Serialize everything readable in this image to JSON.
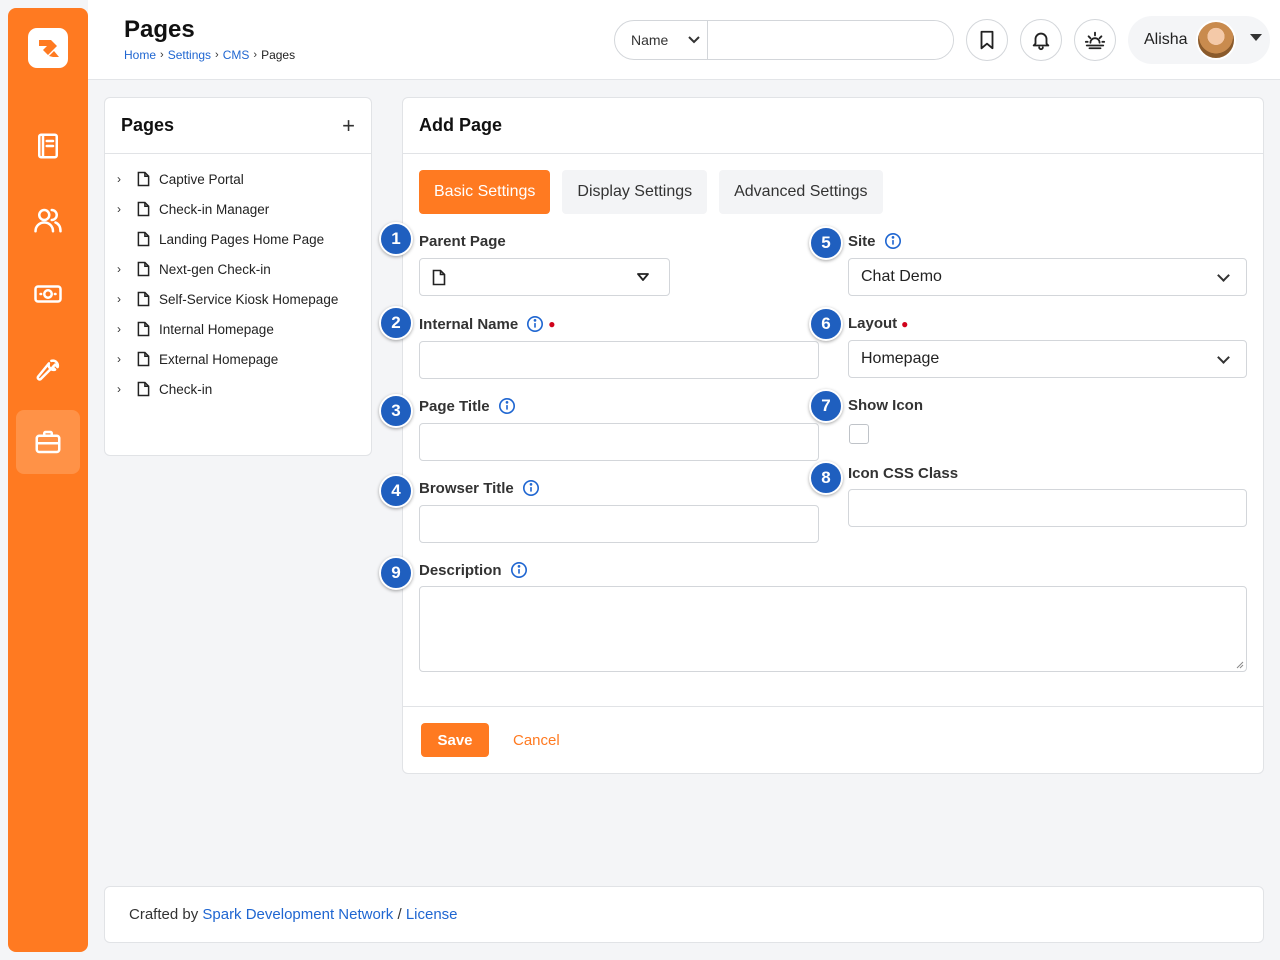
{
  "header": {
    "title": "Pages",
    "breadcrumb": [
      "Home",
      "Settings",
      "CMS",
      "Pages"
    ],
    "search": {
      "filter_label": "Name",
      "placeholder": ""
    },
    "user": {
      "name": "Alisha"
    }
  },
  "sidebar": {
    "items": [
      {
        "icon": "notebook-icon"
      },
      {
        "icon": "people-icon"
      },
      {
        "icon": "money-icon"
      },
      {
        "icon": "wrench-icon"
      },
      {
        "icon": "briefcase-icon",
        "active": true
      }
    ]
  },
  "tree": {
    "title": "Pages",
    "add_label": "+",
    "items": [
      {
        "label": "Captive Portal",
        "expandable": true
      },
      {
        "label": "Check-in Manager",
        "expandable": true
      },
      {
        "label": "Landing Pages Home Page",
        "expandable": false
      },
      {
        "label": "Next-gen Check-in",
        "expandable": true
      },
      {
        "label": "Self-Service Kiosk Homepage",
        "expandable": true
      },
      {
        "label": "Internal Homepage",
        "expandable": true
      },
      {
        "label": "External Homepage",
        "expandable": true
      },
      {
        "label": "Check-in",
        "expandable": true
      }
    ]
  },
  "form": {
    "title": "Add Page",
    "tabs": [
      "Basic Settings",
      "Display Settings",
      "Advanced Settings"
    ],
    "active_tab": "Basic Settings",
    "labels": {
      "parent_page": "Parent Page",
      "internal_name": "Internal Name",
      "page_title": "Page Title",
      "browser_title": "Browser Title",
      "site": "Site",
      "layout": "Layout",
      "show_icon": "Show Icon",
      "icon_css_class": "Icon CSS Class",
      "description": "Description"
    },
    "values": {
      "site": "Chat Demo",
      "layout": "Homepage"
    },
    "badges": [
      "1",
      "2",
      "3",
      "4",
      "5",
      "6",
      "7",
      "8",
      "9"
    ],
    "save_label": "Save",
    "cancel_label": "Cancel"
  },
  "footer": {
    "prefix": "Crafted by",
    "link1": "Spark Development Network",
    "sep": "/",
    "link2": "License"
  },
  "colors": {
    "brand_orange": "#ff7a21",
    "link_blue": "#1f66d1",
    "badge_blue": "#1f5fbf"
  }
}
